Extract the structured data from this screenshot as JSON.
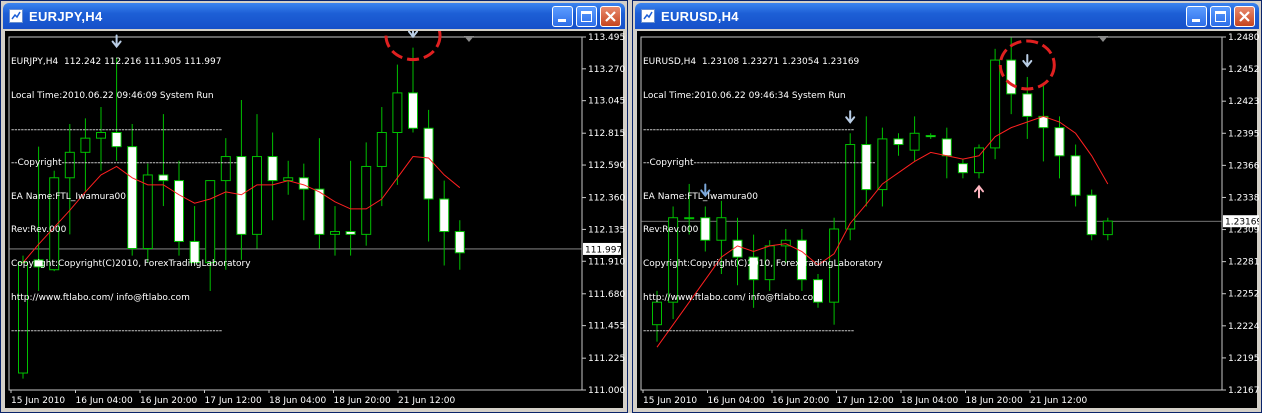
{
  "windows": [
    {
      "key": "left",
      "title": "EURJPY,H4",
      "info": [
        "EURJPY,H4  112.242 112.216 111.905 111.997",
        "Local Time:2010.06.22 09:46:09 System Run",
        "-----------------------------------------------------------------",
        "--Copyright--------------------------------------------------------",
        "EA Name:FTL_Iwamura00",
        "Rev:Rev.000",
        "Copyright:Copyright(C)2010, ForexTradingLaboratory",
        "http://www.ftlabo.com/ info@ftlabo.com",
        "-----------------------------------------------------------------"
      ],
      "price_labels": [
        "113.495",
        "113.270",
        "113.045",
        "112.815",
        "112.590",
        "112.360",
        "112.135",
        "111.910",
        "111.680",
        "111.455",
        "111.225",
        "111.000"
      ],
      "current_price": "111.997",
      "time_labels": [
        "15 Jun 2010",
        "16 Jun 04:00",
        "16 Jun 20:00",
        "17 Jun 12:00",
        "18 Jun 04:00",
        "18 Jun 20:00",
        "21 Jun 12:00"
      ],
      "chart_data": {
        "type": "candlestick",
        "symbol": "EURJPY",
        "timeframe": "H4",
        "ylim": [
          111.0,
          113.495
        ],
        "current": 111.997,
        "candles": [
          [
            111.12,
            111.95,
            111.08,
            111.9
          ],
          [
            111.92,
            112.72,
            111.7,
            111.87
          ],
          [
            111.85,
            112.55,
            111.84,
            112.5
          ],
          [
            112.5,
            112.88,
            112.1,
            112.68
          ],
          [
            112.68,
            112.92,
            112.4,
            112.78
          ],
          [
            112.78,
            113.0,
            112.55,
            112.82
          ],
          [
            112.82,
            113.35,
            112.62,
            112.72
          ],
          [
            112.72,
            112.88,
            111.95,
            112.0
          ],
          [
            112.0,
            112.6,
            111.9,
            112.52
          ],
          [
            112.52,
            112.95,
            112.3,
            112.48
          ],
          [
            112.48,
            112.62,
            111.95,
            112.05
          ],
          [
            112.05,
            112.3,
            111.9,
            111.9
          ],
          [
            111.9,
            112.48,
            111.7,
            112.48
          ],
          [
            112.48,
            112.78,
            111.85,
            112.65
          ],
          [
            112.65,
            113.05,
            111.92,
            112.1
          ],
          [
            112.1,
            112.95,
            112.0,
            112.65
          ],
          [
            112.65,
            112.82,
            112.2,
            112.48
          ],
          [
            112.48,
            112.62,
            112.38,
            112.5
          ],
          [
            112.5,
            112.6,
            112.2,
            112.42
          ],
          [
            112.42,
            112.78,
            112.0,
            112.1
          ],
          [
            112.1,
            112.3,
            111.95,
            112.12
          ],
          [
            112.12,
            112.62,
            111.95,
            112.1
          ],
          [
            112.1,
            112.75,
            112.02,
            112.58
          ],
          [
            112.58,
            113.0,
            112.3,
            112.82
          ],
          [
            112.82,
            113.3,
            112.45,
            113.1
          ],
          [
            113.1,
            113.42,
            112.82,
            112.85
          ],
          [
            112.85,
            112.98,
            112.05,
            112.35
          ],
          [
            112.35,
            112.48,
            111.88,
            112.12
          ],
          [
            112.12,
            112.2,
            111.85,
            111.97
          ]
        ],
        "ma": [
          111.9,
          112.03,
          112.15,
          112.27,
          112.4,
          112.52,
          112.58,
          112.5,
          112.45,
          112.45,
          112.38,
          112.32,
          112.35,
          112.4,
          112.38,
          112.45,
          112.45,
          112.48,
          112.45,
          112.4,
          112.33,
          112.28,
          112.28,
          112.35,
          112.5,
          112.65,
          112.64,
          112.52,
          112.43
        ],
        "arrows": [
          {
            "index": 6,
            "direction": "down",
            "color": "#b9cde5"
          },
          {
            "index": 25,
            "direction": "down",
            "color": "#b9cde5"
          }
        ],
        "highlight_index": 25
      }
    },
    {
      "key": "right",
      "title": "EURUSD,H4",
      "info": [
        "EURUSD,H4  1.23108 1.23271 1.23054 1.23169",
        "Local Time:2010.06.22 09:46:34 System Run",
        "-----------------------------------------------------------------",
        "--Copyright--------------------------------------------------------",
        "EA Name:FTL_Iwamura00",
        "Rev:Rev.000",
        "Copyright:Copyright(C)2010, ForexTradingLaboratory",
        "http://www.ftlabo.com/ info@ftlabo.com",
        "-----------------------------------------------------------------"
      ],
      "price_labels": [
        "1.24805",
        "1.24520",
        "1.24235",
        "1.23950",
        "1.23665",
        "1.23380",
        "1.23095",
        "1.22810",
        "1.22525",
        "1.22240",
        "1.21955",
        "1.21670"
      ],
      "current_price": "1.23169",
      "time_labels": [
        "15 Jun 2010",
        "16 Jun 04:00",
        "16 Jun 20:00",
        "17 Jun 12:00",
        "18 Jun 04:00",
        "18 Jun 20:00",
        "21 Jun 12:00"
      ],
      "chart_data": {
        "type": "candlestick",
        "symbol": "EURUSD",
        "timeframe": "H4",
        "ylim": [
          1.2167,
          1.24805
        ],
        "current": 1.23169,
        "candles": [
          [
            1.2225,
            1.2255,
            1.221,
            1.2245
          ],
          [
            1.2245,
            1.233,
            1.223,
            1.232
          ],
          [
            1.232,
            1.235,
            1.2305,
            1.232
          ],
          [
            1.232,
            1.233,
            1.229,
            1.23
          ],
          [
            1.23,
            1.2335,
            1.227,
            1.232
          ],
          [
            1.23,
            1.232,
            1.226,
            1.2285
          ],
          [
            1.2285,
            1.2305,
            1.224,
            1.2265
          ],
          [
            1.2265,
            1.23,
            1.2255,
            1.2295
          ],
          [
            1.2295,
            1.231,
            1.228,
            1.23
          ],
          [
            1.23,
            1.231,
            1.2255,
            1.2265
          ],
          [
            1.2265,
            1.227,
            1.224,
            1.2245
          ],
          [
            1.2245,
            1.232,
            1.2225,
            1.231
          ],
          [
            1.231,
            1.2395,
            1.23,
            1.2385
          ],
          [
            1.2385,
            1.241,
            1.233,
            1.2345
          ],
          [
            1.2345,
            1.24,
            1.233,
            1.239
          ],
          [
            1.239,
            1.2395,
            1.2375,
            1.2385
          ],
          [
            1.238,
            1.241,
            1.237,
            1.2395
          ],
          [
            1.2393,
            1.2395,
            1.239,
            1.2392
          ],
          [
            1.239,
            1.24,
            1.2355,
            1.2375
          ],
          [
            1.2368,
            1.2372,
            1.2355,
            1.236
          ],
          [
            1.236,
            1.2385,
            1.2355,
            1.2382
          ],
          [
            1.2382,
            1.247,
            1.2372,
            1.246
          ],
          [
            1.246,
            1.248,
            1.2412,
            1.243
          ],
          [
            1.243,
            1.2445,
            1.239,
            1.241
          ],
          [
            1.241,
            1.244,
            1.237,
            1.24
          ],
          [
            1.24,
            1.241,
            1.2355,
            1.2375
          ],
          [
            1.2375,
            1.2385,
            1.233,
            1.234
          ],
          [
            1.234,
            1.2345,
            1.23,
            1.2305
          ],
          [
            1.2305,
            1.232,
            1.23,
            1.2317
          ]
        ],
        "ma": [
          1.2205,
          1.2225,
          1.2245,
          1.2265,
          1.2285,
          1.2295,
          1.229,
          1.2295,
          1.2297,
          1.229,
          1.2278,
          1.2288,
          1.2315,
          1.2332,
          1.235,
          1.236,
          1.237,
          1.2378,
          1.2375,
          1.2372,
          1.2375,
          1.2392,
          1.24,
          1.2405,
          1.241,
          1.2405,
          1.2395,
          1.2375,
          1.235
        ],
        "arrows": [
          {
            "index": 3,
            "direction": "down",
            "color": "#7aa6d8"
          },
          {
            "index": 12,
            "direction": "down",
            "color": "#b9cde5"
          },
          {
            "index": 20,
            "direction": "up",
            "color": "#ffb6c1"
          },
          {
            "index": 23,
            "direction": "down",
            "color": "#b9cde5"
          }
        ],
        "highlight_index": 23
      }
    }
  ]
}
